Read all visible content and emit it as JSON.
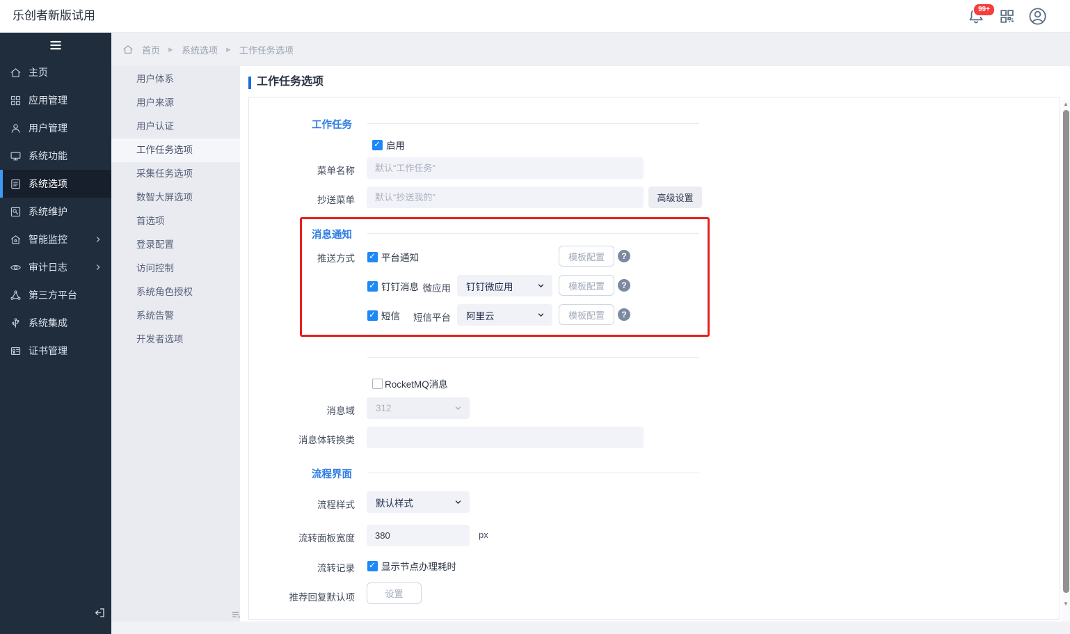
{
  "header": {
    "title": "乐创者新版试用",
    "notification_count": "99+"
  },
  "sidebar": {
    "items": [
      {
        "label": "主页"
      },
      {
        "label": "应用管理"
      },
      {
        "label": "用户管理"
      },
      {
        "label": "系统功能"
      },
      {
        "label": "系统选项"
      },
      {
        "label": "系统维护"
      },
      {
        "label": "智能监控"
      },
      {
        "label": "审计日志"
      },
      {
        "label": "第三方平台"
      },
      {
        "label": "系统集成"
      },
      {
        "label": "证书管理"
      }
    ]
  },
  "subnav": {
    "items": [
      "用户体系",
      "用户来源",
      "用户认证",
      "工作任务选项",
      "采集任务选项",
      "数智大屏选项",
      "首选项",
      "登录配置",
      "访问控制",
      "系统角色授权",
      "系统告警",
      "开发者选项"
    ]
  },
  "breadcrumb": {
    "items": [
      "首页",
      "系统选项",
      "工作任务选项"
    ]
  },
  "page": {
    "title": "工作任务选项"
  },
  "form": {
    "task": {
      "section_title": "工作任务",
      "enable_label": "启用",
      "menu_name_label": "菜单名称",
      "menu_name_placeholder": "默认“工作任务”",
      "cc_menu_label": "抄送菜单",
      "cc_menu_placeholder": "默认“抄送我的”",
      "advanced_button": "高级设置"
    },
    "notify": {
      "section_title": "消息通知",
      "push_method_label": "推送方式",
      "platform": {
        "checkbox_label": "平台通知",
        "template_button": "模板配置"
      },
      "dingtalk": {
        "checkbox_label": "钉钉消息",
        "sub_label": "微应用",
        "selected": "钉钉微应用",
        "template_button": "模板配置"
      },
      "sms": {
        "checkbox_label": "短信",
        "sub_label": "短信平台",
        "selected": "阿里云",
        "template_button": "模板配置"
      },
      "rocketmq_label": "RocketMQ消息",
      "domain_label": "消息域",
      "domain_value": "312",
      "converter_label": "消息体转换类"
    },
    "flow": {
      "section_title": "流程界面",
      "style_label": "流程样式",
      "style_value": "默认样式",
      "width_label": "流转面板宽度",
      "width_value": "380",
      "width_unit": "px",
      "record_label": "流转记录",
      "record_checkbox_label": "显示节点办理耗时",
      "reply_label": "推荐回复默认项",
      "reply_button": "设置"
    }
  },
  "colors": {
    "accent_blue": "#1e88f7",
    "section_blue": "#2e7de4",
    "highlight_red": "#e4201e",
    "sidebar_bg": "#1f2d3d",
    "badge_red": "#f53f3f"
  }
}
